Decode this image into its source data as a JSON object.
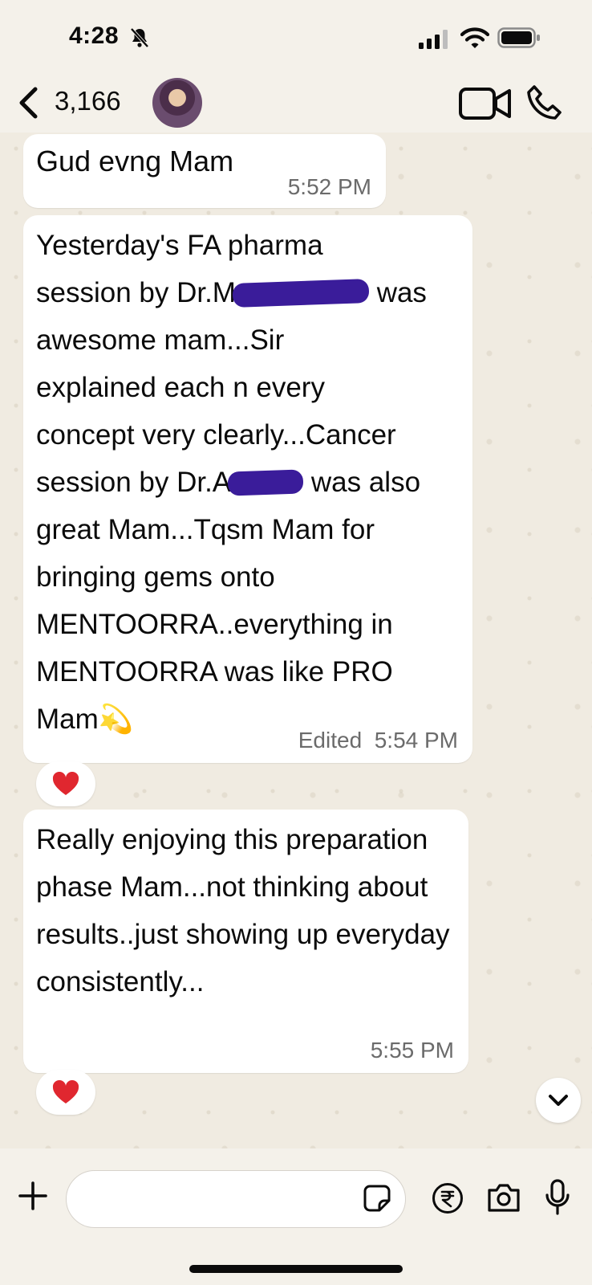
{
  "status_bar": {
    "time": "4:28"
  },
  "header": {
    "unread_count": "3,166"
  },
  "messages": [
    {
      "id": "msg1",
      "text": "Gud evng Mam",
      "time": "5:52 PM"
    },
    {
      "id": "msg2",
      "lines": {
        "l1": "Yesterday's FA pharma",
        "l2a": "session by Dr.M",
        "l2b": " was",
        "l3": "awesome mam...Sir",
        "l4": "explained each n every",
        "l5": "concept very clearly...Cancer",
        "l6a": "session by Dr.A",
        "l6b": " was also",
        "l7": "great Mam...Tqsm Mam for",
        "l8": "bringing gems onto",
        "l9": "MENTOORRA..everything in",
        "l10": "MENTOORRA was like PRO",
        "l11": "Mam"
      },
      "emoji": "💫",
      "edited_label": "Edited",
      "time": "5:54 PM",
      "reaction": "❤️"
    },
    {
      "id": "msg3",
      "text": "Really enjoying this preparation phase Mam...not thinking about results..just showing up everyday consistently...",
      "time": "5:55 PM",
      "reaction": "❤️"
    }
  ],
  "input": {
    "placeholder": ""
  },
  "icons": {
    "back": "chevron-left-icon",
    "video": "video-camera-icon",
    "call": "phone-icon",
    "plus": "plus-icon",
    "sticker": "sticker-icon",
    "payment": "rupee-icon",
    "camera": "camera-icon",
    "mic": "microphone-icon"
  }
}
